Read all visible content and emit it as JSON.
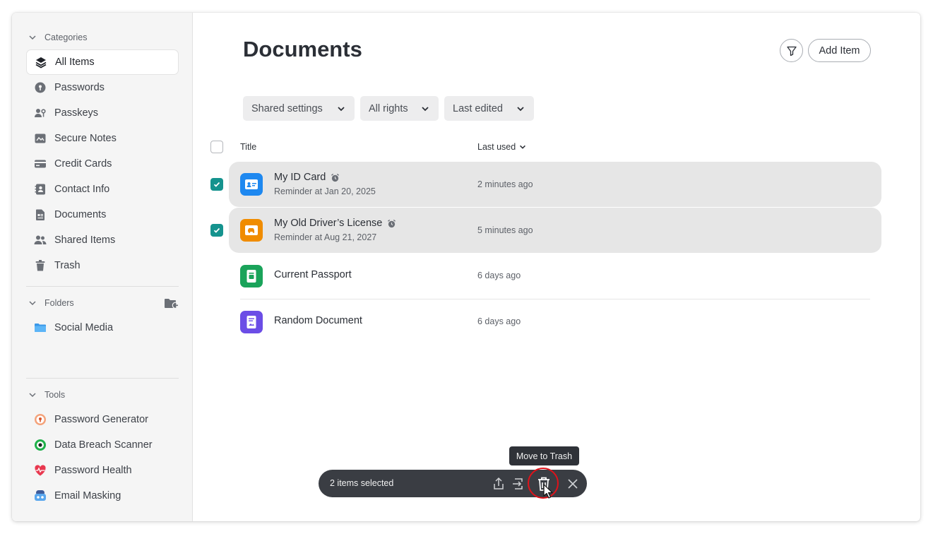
{
  "sidebar": {
    "categories_title": "Categories",
    "categories": [
      {
        "label": "All Items",
        "icon": "stack-icon",
        "active": true
      },
      {
        "label": "Passwords",
        "icon": "key-icon"
      },
      {
        "label": "Passkeys",
        "icon": "passkey-icon"
      },
      {
        "label": "Secure Notes",
        "icon": "note-icon"
      },
      {
        "label": "Credit Cards",
        "icon": "credit-card-icon"
      },
      {
        "label": "Contact Info",
        "icon": "contact-icon"
      },
      {
        "label": "Documents",
        "icon": "document-icon"
      },
      {
        "label": "Shared Items",
        "icon": "people-icon"
      },
      {
        "label": "Trash",
        "icon": "trash-icon"
      }
    ],
    "folders_title": "Folders",
    "folders": [
      {
        "label": "Social Media",
        "icon": "folder-icon"
      }
    ],
    "tools_title": "Tools",
    "tools": [
      {
        "label": "Password Generator",
        "icon": "generator-icon"
      },
      {
        "label": "Data Breach Scanner",
        "icon": "scanner-icon"
      },
      {
        "label": "Password Health",
        "icon": "health-icon"
      },
      {
        "label": "Email Masking",
        "icon": "mask-icon"
      }
    ]
  },
  "main": {
    "title": "Documents",
    "add_item_label": "Add Item",
    "filters": [
      "Shared settings",
      "All rights",
      "Last edited"
    ],
    "columns": {
      "title": "Title",
      "last_used": "Last used"
    },
    "rows": [
      {
        "name": "My ID Card",
        "sub": "Reminder at Jan 20, 2025",
        "when": "2 minutes ago",
        "selected": true,
        "color": "#1e88f0",
        "icon": "id-card-icon"
      },
      {
        "name": "My Old Driver’s License",
        "sub": "Reminder at Aug 21, 2027",
        "when": "5 minutes ago",
        "selected": true,
        "color": "#f08c00",
        "icon": "license-icon"
      },
      {
        "name": "Current Passport",
        "sub": "",
        "when": "6 days ago",
        "selected": false,
        "color": "#1aa35a",
        "icon": "passport-icon"
      },
      {
        "name": "Random Document",
        "sub": "",
        "when": "6 days ago",
        "selected": false,
        "color": "#6b4de6",
        "icon": "generic-document-icon"
      }
    ]
  },
  "selection_bar": {
    "count_label": "2 items selected",
    "tooltip": "Move to Trash"
  },
  "colors": {
    "accent": "#15938e",
    "highlight_ring": "#e0121a"
  }
}
